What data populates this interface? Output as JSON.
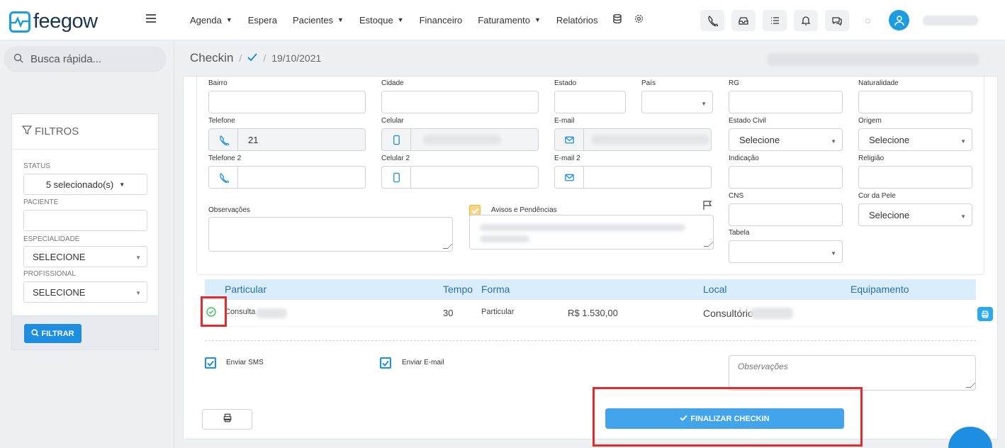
{
  "app": {
    "logo_text": "feegow",
    "brand_color": "#1b9be0"
  },
  "nav": {
    "items": [
      {
        "label": "Agenda",
        "dropdown": true
      },
      {
        "label": "Espera",
        "dropdown": false
      },
      {
        "label": "Pacientes",
        "dropdown": true
      },
      {
        "label": "Estoque",
        "dropdown": true
      },
      {
        "label": "Financeiro",
        "dropdown": false
      },
      {
        "label": "Faturamento",
        "dropdown": true
      },
      {
        "label": "Relatórios",
        "dropdown": false
      }
    ],
    "icons": [
      "database-icon",
      "gear-icon"
    ],
    "toolbar_icons": [
      "phone-icon",
      "inbox-icon",
      "checklist-icon",
      "bell-icon",
      "chat-icon"
    ]
  },
  "sidebar": {
    "search_placeholder": "Busca rápida...",
    "filters_title": "FILTROS",
    "status_label": "STATUS",
    "status_value": "5 selecionado(s)",
    "paciente_label": "PACIENTE",
    "especialidade_label": "ESPECIALIDADE",
    "especialidade_value": "SELECIONE",
    "profissional_label": "PROFISSIONAL",
    "profissional_value": "SELECIONE",
    "filtrar_label": "FILTRAR"
  },
  "breadcrumb": {
    "title": "Checkin",
    "date": "19/10/2021"
  },
  "form": {
    "bairro": "Bairro",
    "cidade": "Cidade",
    "estado": "Estado",
    "pais": "País",
    "rg": "RG",
    "naturalidade": "Naturalidade",
    "telefone": "Telefone",
    "telefone_value": "21",
    "celular": "Celular",
    "email": "E-mail",
    "estado_civil": "Estado Civil",
    "estado_civil_value": "Selecione",
    "origem": "Origem",
    "origem_value": "Selecione",
    "telefone2": "Telefone 2",
    "celular2": "Celular 2",
    "email2": "E-mail 2",
    "indicacao": "Indicação",
    "religiao": "Religião",
    "cns": "CNS",
    "cor_pele": "Cor da Pele",
    "cor_pele_value": "Selecione",
    "observacoes": "Observações",
    "avisos": "Avisos e Pendências",
    "tabela": "Tabela"
  },
  "table": {
    "headers": {
      "particular": "Particular",
      "tempo": "Tempo",
      "forma": "Forma",
      "local": "Local",
      "equipamento": "Equipamento"
    },
    "row": {
      "procedimento": "Consulta",
      "tempo": "30",
      "forma": "Particular",
      "valor": "R$ 1.530,00",
      "local": "Consultório"
    }
  },
  "options": {
    "enviar_sms": "Enviar SMS",
    "enviar_email": "Enviar E-mail",
    "observacoes_placeholder": "Observações"
  },
  "actions": {
    "finalizar": "FINALIZAR CHECKIN"
  },
  "colors": {
    "accent": "#1e8fe0",
    "annotation": "#e32b2b",
    "table_header_bg": "#d9eefa"
  }
}
